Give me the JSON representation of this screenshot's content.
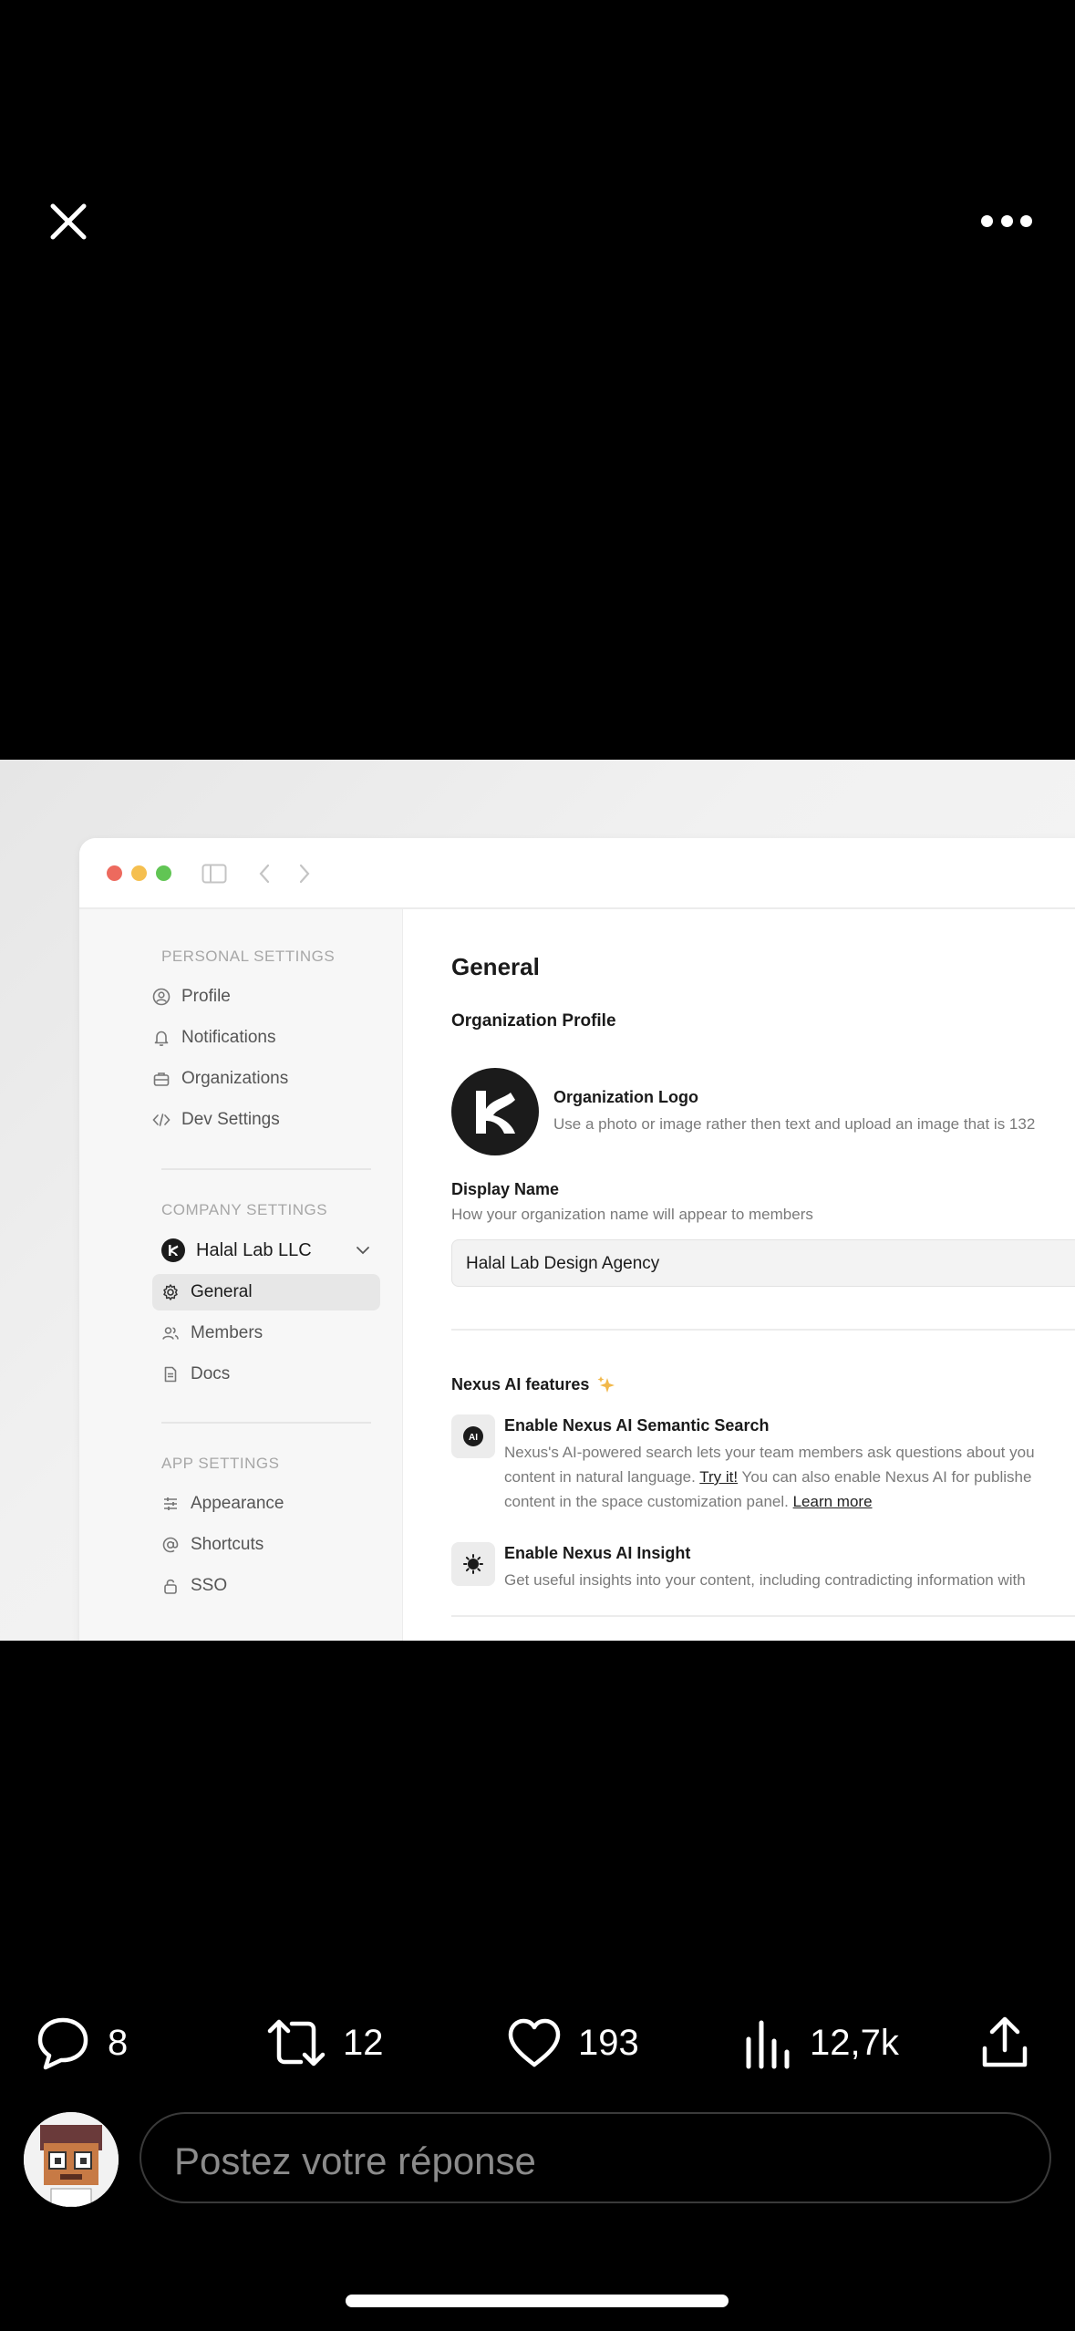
{
  "media": {
    "window": {
      "traffic_colors": [
        "#ed6a5e",
        "#f5bf4f",
        "#61c554"
      ],
      "sidebar": {
        "personal_label": "PERSONAL SETTINGS",
        "personal_items": [
          {
            "label": "Profile",
            "icon": "user-circle-icon"
          },
          {
            "label": "Notifications",
            "icon": "bell-icon"
          },
          {
            "label": "Organizations",
            "icon": "briefcase-icon"
          },
          {
            "label": "Dev Settings",
            "icon": "code-icon"
          }
        ],
        "company_label": "COMPANY SETTINGS",
        "company_name": "Halal Lab LLC",
        "company_items": [
          {
            "label": "General",
            "icon": "gear-icon",
            "active": true
          },
          {
            "label": "Members",
            "icon": "users-icon"
          },
          {
            "label": "Docs",
            "icon": "document-icon"
          }
        ],
        "app_label": "APP SETTINGS",
        "app_items": [
          {
            "label": "Appearance",
            "icon": "sliders-icon"
          },
          {
            "label": "Shortcuts",
            "icon": "at-icon"
          },
          {
            "label": "SSO",
            "icon": "lock-icon"
          }
        ]
      },
      "main": {
        "title": "General",
        "org_profile_heading": "Organization Profile",
        "logo_title": "Organization Logo",
        "logo_desc": "Use a photo or image rather then text and upload an image that is 132",
        "display_name_label": "Display Name",
        "display_name_desc": "How your organization name will appear to members",
        "display_name_value": "Halal Lab Design Agency",
        "ai_heading": "Nexus AI features",
        "ai_search_title": "Enable Nexus AI Semantic Search",
        "ai_search_desc_1": "Nexus's AI-powered search lets your team members ask questions about you",
        "ai_search_desc_2a": "content in natural language. ",
        "ai_search_link_try": "Try it!",
        "ai_search_desc_2b": " You can also enable Nexus AI for publishe",
        "ai_search_desc_3a": "content in the space customization panel. ",
        "ai_search_link_learn": "Learn more",
        "ai_insight_title": "Enable Nexus AI Insight",
        "ai_insight_desc": "Get useful insights into your content, including contradicting information with"
      }
    }
  },
  "actions": {
    "replies": "8",
    "reposts": "12",
    "likes": "193",
    "views": "12,7k"
  },
  "reply": {
    "placeholder": "Postez votre réponse"
  }
}
